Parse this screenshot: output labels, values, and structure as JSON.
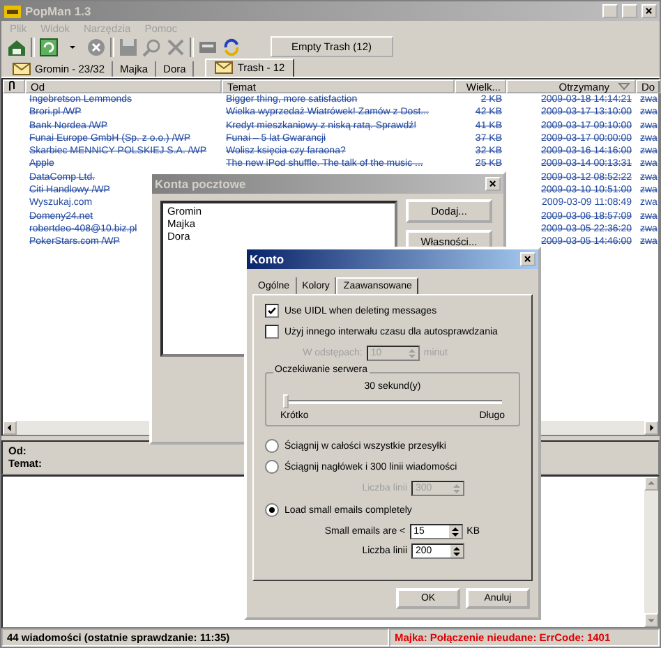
{
  "window": {
    "title": "PopMan 1.3"
  },
  "menu": [
    {
      "label": "Plik",
      "disabled": true
    },
    {
      "label": "Widok",
      "disabled": true
    },
    {
      "label": "Narzędzia",
      "disabled": true
    },
    {
      "label": "Pomoc",
      "disabled": true
    }
  ],
  "toolbar": {
    "empty_trash_button": "Empty Trash (12)"
  },
  "tabs": [
    {
      "label": "Gromin - 23/32",
      "selected": false,
      "icon": true
    },
    {
      "label": "Majka",
      "selected": false,
      "icon": false
    },
    {
      "label": "Dora",
      "selected": false,
      "icon": false
    },
    {
      "label": "Trash - 12",
      "selected": true,
      "icon": true
    }
  ],
  "columns": [
    "Od",
    "Temat",
    "Wielk...",
    "Otrzymany",
    "Do"
  ],
  "messages": [
    {
      "from": "Ingebretson Lemmonds",
      "subject": "Bigger thing, more satisfaction",
      "size": "2 KB",
      "received": "2009-03-18 14:14:21",
      "to": "zwa",
      "deleted": true
    },
    {
      "from": "Brori.pl /WP",
      "subject": "Wielka wyprzedaż Wiatrówek! Zamów z Dost...",
      "size": "42 KB",
      "received": "2009-03-17 13:10:00",
      "to": "zwa",
      "deleted": true
    },
    {
      "from": "Bank Nordea /WP",
      "subject": "Kredyt mieszkaniowy z niską ratą. Sprawdź!",
      "size": "41 KB",
      "received": "2009-03-17 09:10:00",
      "to": "zwa",
      "deleted": true
    },
    {
      "from": "Funai Europe GmbH (Sp. z o.o.) /WP",
      "subject": "Funai – 5 lat Gwarancji",
      "size": "37 KB",
      "received": "2009-03-17 00:00:00",
      "to": "zwa",
      "deleted": true
    },
    {
      "from": "Skarbiec MENNICY POLSKIEJ S.A. /WP",
      "subject": "Wolisz księcia czy faraona?",
      "size": "32 KB",
      "received": "2009-03-16 14:16:00",
      "to": "zwa",
      "deleted": true
    },
    {
      "from": "Apple",
      "subject": "The new iPod shuffle. The talk of the music ...",
      "size": "25 KB",
      "received": "2009-03-14 00:13:31",
      "to": "zwa",
      "deleted": true
    },
    {
      "from": "DataComp Ltd.",
      "received": "2009-03-12 08:52:22",
      "to": "zwa",
      "deleted": true
    },
    {
      "from": "Citi Handlowy /WP",
      "received": "2009-03-10 10:51:00",
      "to": "zwa",
      "deleted": true
    },
    {
      "from": "Wyszukaj.com",
      "received": "2009-03-09 11:08:49",
      "to": "zwa",
      "deleted": false
    },
    {
      "from": "Domeny24.net",
      "received": "2009-03-06 18:57:09",
      "to": "zwa",
      "deleted": true
    },
    {
      "from": "robertdeo-408@10.biz.pl",
      "received": "2009-03-05 22:36:20",
      "to": "zwa",
      "deleted": true
    },
    {
      "from": "PokerStars.com /WP",
      "received": "2009-03-05 14:46:00",
      "to": "zwa",
      "deleted": true
    }
  ],
  "preview": {
    "from_label": "Od:",
    "subject_label": "Temat:"
  },
  "status_bar": {
    "summary": "44 wiadomości (ostatnie sprawdzanie: 11:35)",
    "error": "Majka:  Połączenie nieudane: ErrCode: 1401"
  },
  "accounts_dialog": {
    "title": "Konta pocztowe",
    "accounts": [
      "Gromin",
      "Majka",
      "Dora"
    ],
    "buttons": [
      "Dodaj...",
      "Własności..."
    ]
  },
  "account_dialog": {
    "title": "Konto",
    "tabs": [
      {
        "label": "Ogólne",
        "selected": false
      },
      {
        "label": "Kolory",
        "selected": false
      },
      {
        "label": "Zaawansowane",
        "selected": true
      }
    ],
    "use_uidl": {
      "label": "Use UIDL when deleting messages",
      "checked": true
    },
    "custom_interval": {
      "label": "Użyj innego interwału czasu dla autosprawdzania",
      "checked": false
    },
    "interval": {
      "label": "W odstępach:",
      "value": "10",
      "unit": "minut",
      "disabled": true
    },
    "server_wait": {
      "title": "Oczekiwanie serwera",
      "reading": "30 sekund(y)",
      "level": 0.0,
      "min_label": "Krótko",
      "max_label": "Długo"
    },
    "download": [
      {
        "label": "Ściągnij w całości wszystkie przesyłki",
        "selected": false
      },
      {
        "label": "Ściągnij nagłówek i 300 linii wiadomości",
        "selected": false
      },
      {
        "label": "Load small emails completely",
        "selected": true
      }
    ],
    "header_lines": {
      "label": "Liczba linii",
      "value": "300",
      "disabled": true
    },
    "small_size": {
      "label": "Small emails are <",
      "value": "15",
      "unit": "KB",
      "disabled": false
    },
    "small_lines": {
      "label": "Liczba linii",
      "value": "200",
      "disabled": false
    },
    "buttons": [
      "OK",
      "Anuluj"
    ]
  }
}
